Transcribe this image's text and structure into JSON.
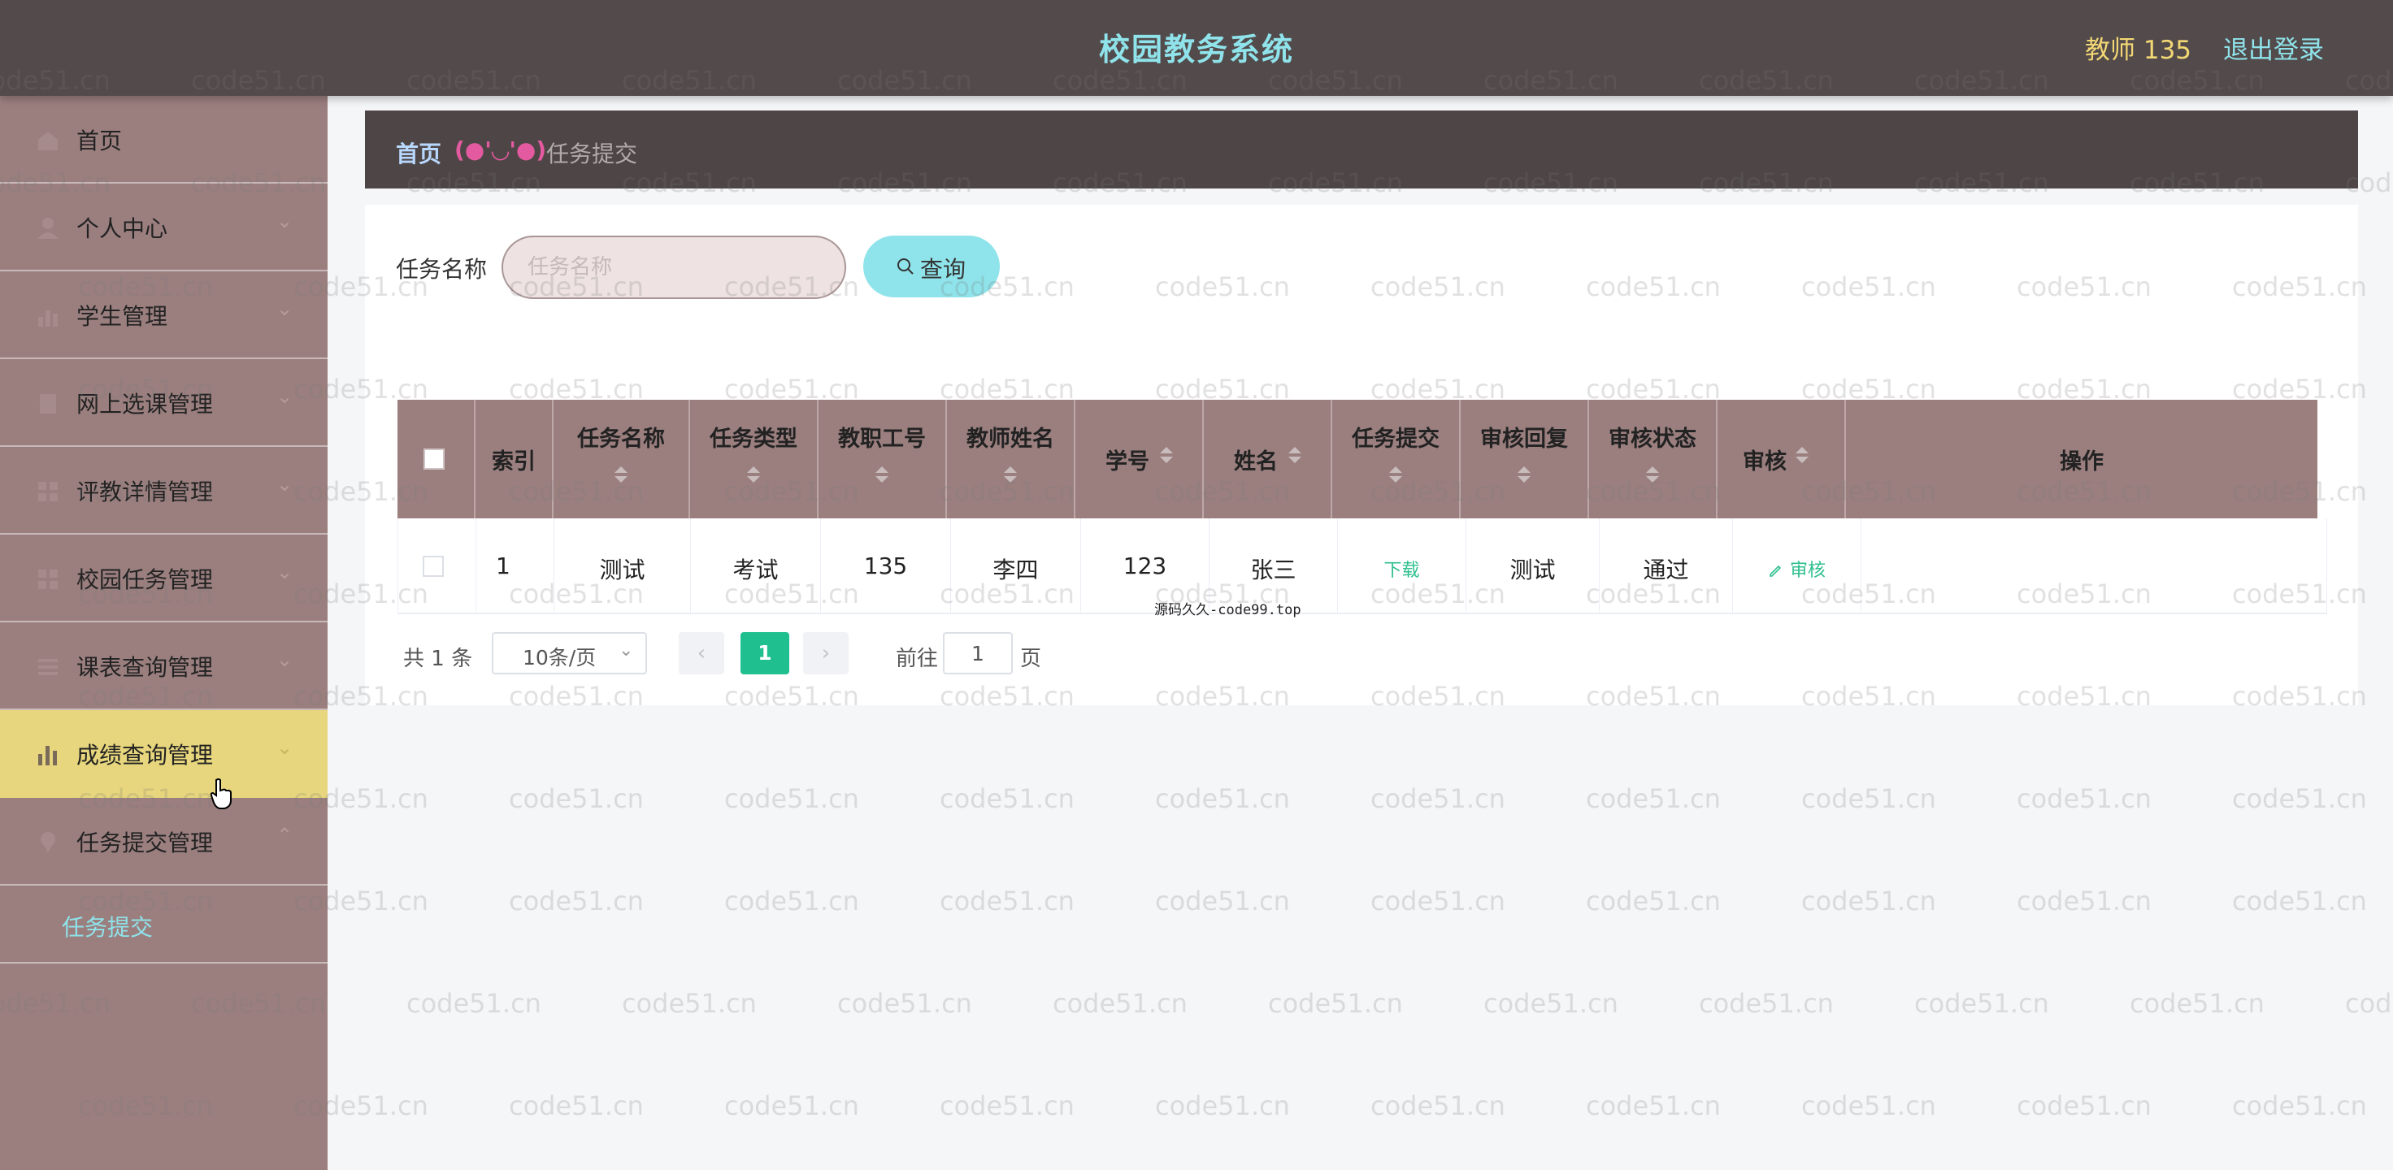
{
  "header": {
    "app_title": "校园教务系统",
    "user": "教师 135",
    "logout": "退出登录"
  },
  "sidebar": {
    "items": [
      {
        "label": "首页",
        "icon": "home-icon"
      },
      {
        "label": "个人中心",
        "icon": "user-icon"
      },
      {
        "label": "学生管理",
        "icon": "chart-icon"
      },
      {
        "label": "网上选课管理",
        "icon": "document-icon"
      },
      {
        "label": "评教详情管理",
        "icon": "grid-icon"
      },
      {
        "label": "校园任务管理",
        "icon": "grid-icon"
      },
      {
        "label": "课表查询管理",
        "icon": "list-icon"
      },
      {
        "label": "成绩查询管理",
        "icon": "bar-chart-icon",
        "active": true
      },
      {
        "label": "任务提交管理",
        "icon": "pin-icon",
        "expanded": true
      }
    ],
    "subitems": [
      {
        "label": "任务提交"
      }
    ]
  },
  "breadcrumb": {
    "home": "首页",
    "separator": "(●'◡'●)",
    "current": "任务提交"
  },
  "search": {
    "label": "任务名称",
    "placeholder": "任务名称",
    "button_label": "查询"
  },
  "table": {
    "columns": [
      "索引",
      "任务名称",
      "任务类型",
      "教职工号",
      "教师姓名",
      "学号",
      "姓名",
      "任务提交",
      "审核回复",
      "审核状态",
      "审核",
      "操作"
    ],
    "rows": [
      {
        "index": "1",
        "task_name": "测试",
        "task_type": "考试",
        "staff_no": "135",
        "teacher_name": "李四",
        "student_no": "123",
        "student_name": "张三",
        "submission": "下载",
        "review_reply": "测试",
        "review_status": "通过",
        "review_action": "审核"
      }
    ],
    "overlay_note": "源码久久-code99.top"
  },
  "pagination": {
    "total": "共 1 条",
    "page_size": "10条/页",
    "current_page": "1",
    "goto_label": "前往",
    "goto_value": "1",
    "page_suffix": "页"
  },
  "watermark": "code51.cn",
  "colors": {
    "header_bg": "#534b4b",
    "sidebar_bg": "#9b7f7f",
    "active_menu": "#e7d67d",
    "accent_cyan": "#8fe3ea",
    "accent_green": "#1fbf8f",
    "user_gold": "#f2d774"
  }
}
